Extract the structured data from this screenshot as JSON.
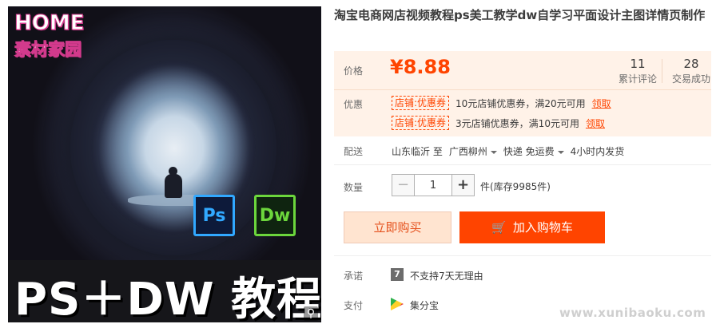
{
  "product_image": {
    "logo_line1": "HOME",
    "logo_line2": "素材家园",
    "badge_ps": "Ps",
    "badge_dw": "Dw",
    "bottom_title": "PS＋DW 教程",
    "zoom_icon": "magnifier-icon"
  },
  "title": "淘宝电商网店视频教程ps美工教学dw自学习平面设计主图详情页制作",
  "price": {
    "label": "价格",
    "value": "¥8.88",
    "reviews_count": "11",
    "reviews_label": "累计评论",
    "sales_count": "28",
    "sales_label": "交易成功"
  },
  "promotions": {
    "label": "优惠",
    "coupons": [
      {
        "tag": "店铺:优惠券",
        "text": "10元店铺优惠券，满20元可用",
        "link": "领取"
      },
      {
        "tag": "店铺:优惠券",
        "text": "3元店铺优惠券，满10元可用",
        "link": "领取"
      }
    ]
  },
  "shipping": {
    "label": "配送",
    "from": "山东临沂 至",
    "to": "广西柳州",
    "method": "快递 免运费",
    "dispatch": "4小时内发货"
  },
  "quantity": {
    "label": "数量",
    "value": "1",
    "minus": "−",
    "plus": "+",
    "stock": "件(库存9985件)"
  },
  "buttons": {
    "buy_now": "立即购买",
    "add_to_cart": "加入购物车"
  },
  "promise": {
    "label": "承诺",
    "icon_text": "7",
    "text": "不支持7天无理由"
  },
  "payment": {
    "label": "支付",
    "text": "集分宝"
  },
  "watermark": "www.xunibaoku.com",
  "colors": {
    "accent": "#ff4400",
    "price_bg": "#fff2e8",
    "buy_bg": "#ffe4d0"
  }
}
